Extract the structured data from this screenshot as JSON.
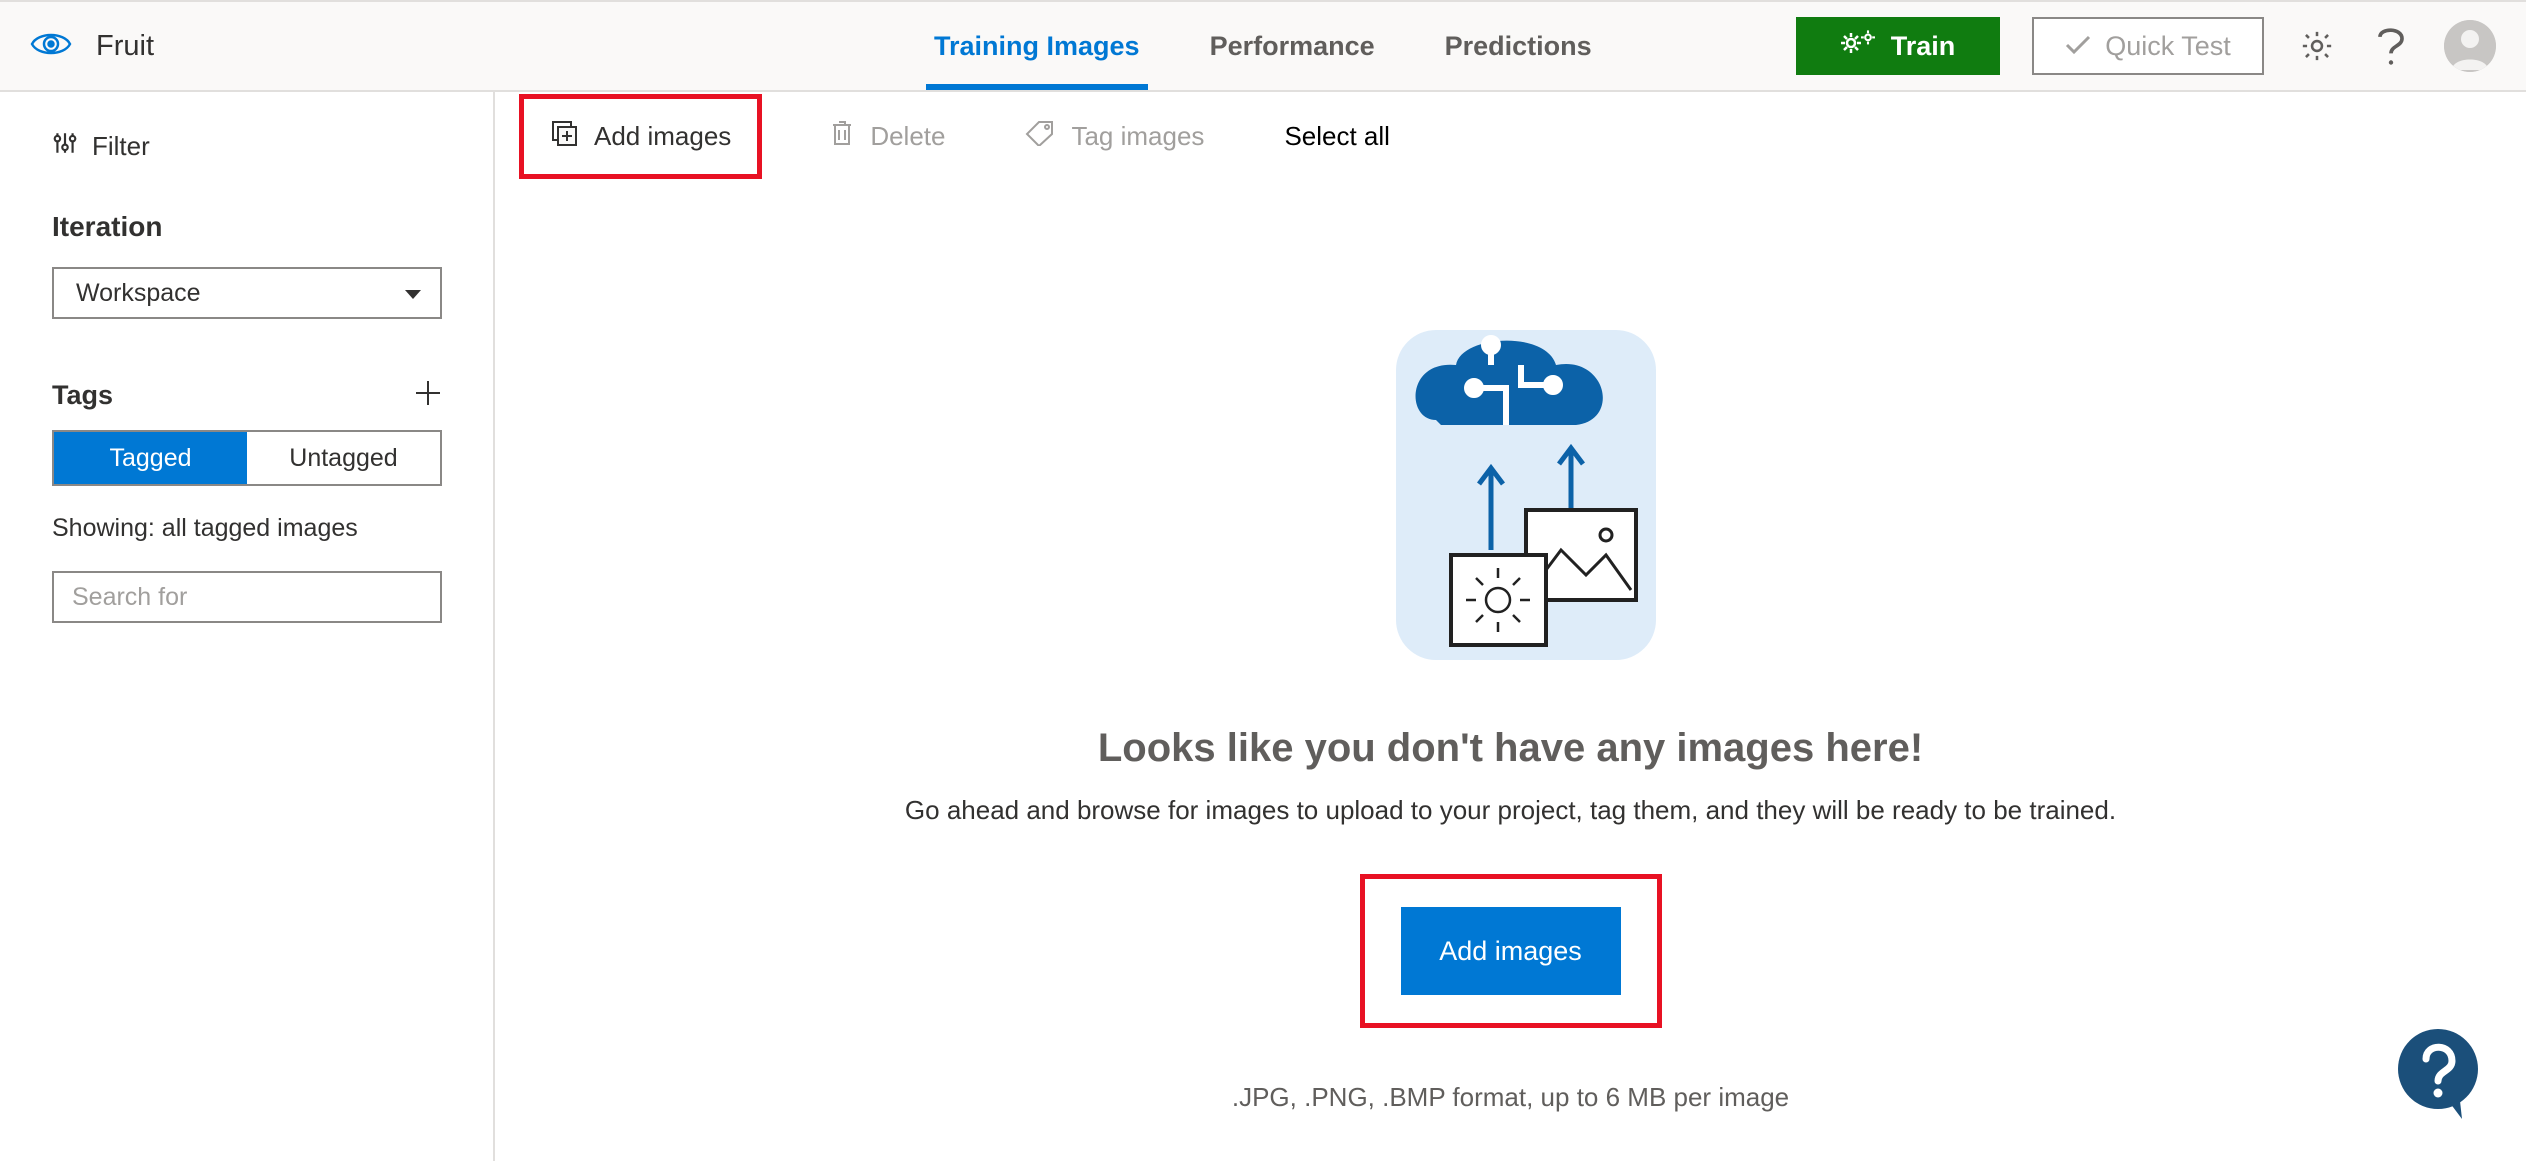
{
  "header": {
    "project_name": "Fruit",
    "tabs": {
      "training": "Training Images",
      "performance": "Performance",
      "predictions": "Predictions"
    },
    "train_label": "Train",
    "quick_test_label": "Quick Test"
  },
  "sidebar": {
    "filter_label": "Filter",
    "iteration_heading": "Iteration",
    "iteration_selected": "Workspace",
    "tags_heading": "Tags",
    "toggle_tagged": "Tagged",
    "toggle_untagged": "Untagged",
    "showing_text": "Showing: all tagged images",
    "search_placeholder": "Search for"
  },
  "toolbar": {
    "add_images": "Add images",
    "delete": "Delete",
    "tag_images": "Tag images",
    "select_all": "Select all"
  },
  "empty": {
    "title": "Looks like you don't have any images here!",
    "subtitle": "Go ahead and browse for images to upload to your project, tag them, and they will be ready to be trained.",
    "add_button": "Add images",
    "hint": ".JPG, .PNG, .BMP format, up to 6 MB per image"
  }
}
